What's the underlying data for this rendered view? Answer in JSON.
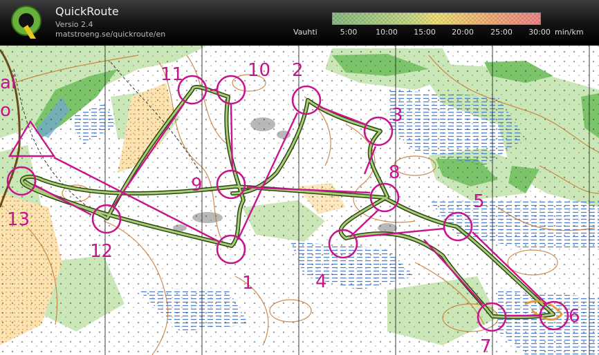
{
  "app": {
    "name": "QuickRoute",
    "version": "Versio 2.4",
    "url": "matstroeng.se/quickroute/en",
    "logo_letter": "Q"
  },
  "legend": {
    "label": "Vauhti",
    "ticks": [
      "5:00",
      "10:00",
      "15:00",
      "20:00",
      "25:00",
      "30:00"
    ],
    "unit": "min/km",
    "colors": [
      "#8cc084",
      "#c4d98a",
      "#f0e47a",
      "#f4b37a",
      "#f08a8a"
    ]
  },
  "map": {
    "edge_text": [
      "ai",
      "o"
    ],
    "course_color": "#c8148c",
    "route_color": "#4a6b1c",
    "controls": [
      "1",
      "2",
      "3",
      "4",
      "5",
      "6",
      "7",
      "8",
      "9",
      "10",
      "11",
      "12",
      "13"
    ]
  }
}
